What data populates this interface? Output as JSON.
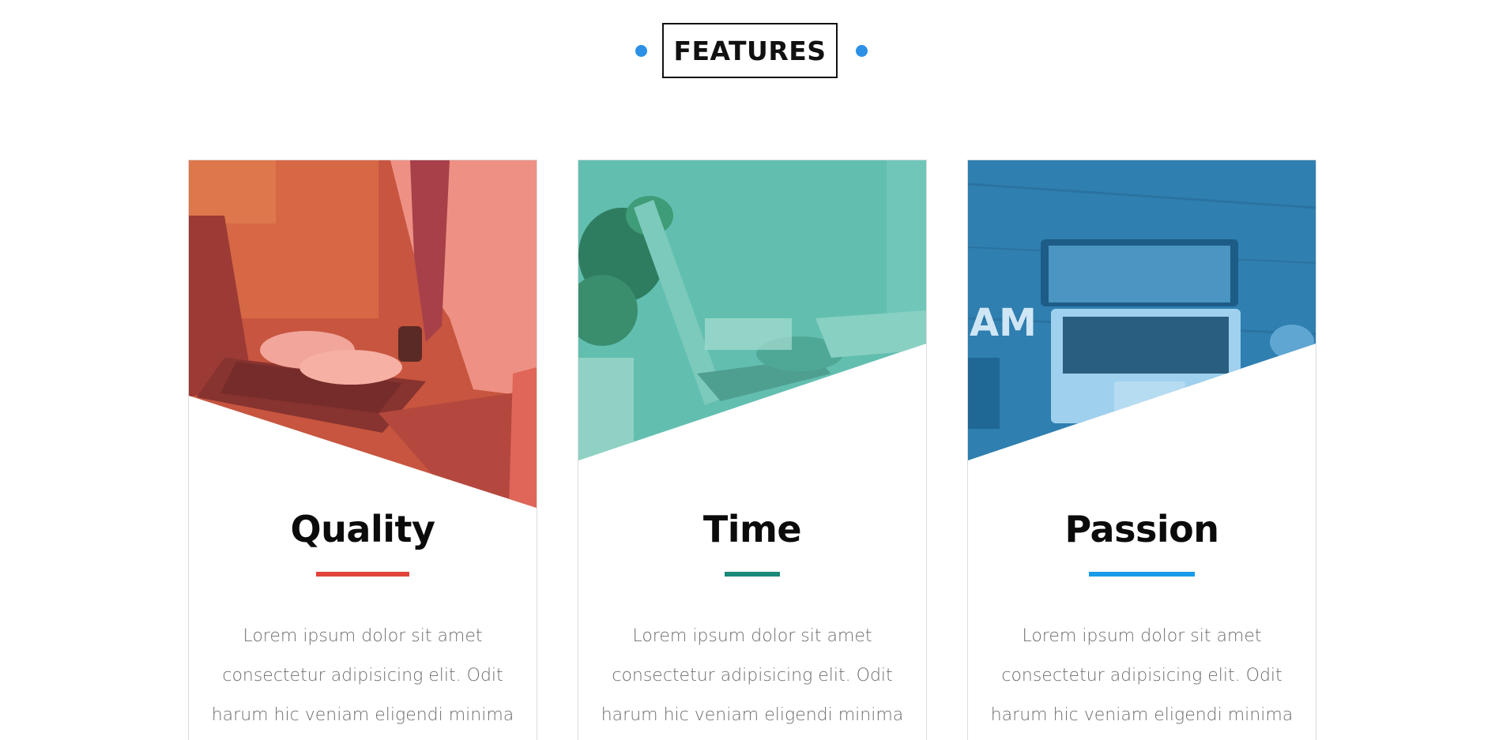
{
  "section": {
    "title": "FEATURES",
    "accent_color": "#2b90e6"
  },
  "cards": [
    {
      "title": "Quality",
      "accent_color": "#e0443a",
      "image_tint": "#e05a4a",
      "image_subject": "person typing on laptop",
      "text_lines": [
        "Lorem ipsum dolor sit amet",
        "consectetur adipisicing elit. Odit",
        "harum hic veniam eligendi minima"
      ]
    },
    {
      "title": "Time",
      "accent_color": "#1a8a7a",
      "image_tint": "#4fb8a6",
      "image_subject": "hands on laptop with plant",
      "text_lines": [
        "Lorem ipsum dolor sit amet",
        "consectetur adipisicing elit. Odit",
        "harum hic veniam eligendi minima"
      ]
    },
    {
      "title": "Passion",
      "accent_color": "#1a9be8",
      "image_tint": "#2a7fb6",
      "image_subject": "laptop on wooden desk",
      "text_lines": [
        "Lorem ipsum dolor sit amet",
        "consectetur adipisicing elit. Odit",
        "harum hic veniam eligendi minima"
      ]
    }
  ]
}
